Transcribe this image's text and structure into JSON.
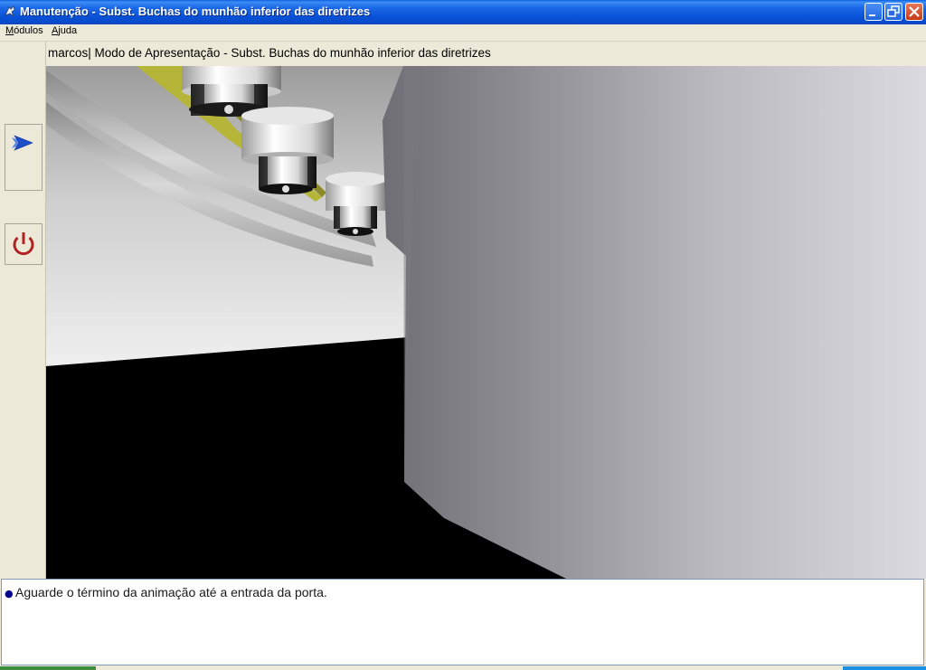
{
  "window": {
    "title": "Manutenção - Subst. Buchas do munhão inferior das diretrizes",
    "controls": [
      "minimize",
      "restore",
      "close"
    ]
  },
  "menubar": {
    "items": [
      {
        "label": "Módulos",
        "accel": "M",
        "rest": "ódulos"
      },
      {
        "label": "Ajuda",
        "accel": "A",
        "rest": "juda"
      }
    ]
  },
  "toolbar": {
    "buttons": [
      {
        "name": "next",
        "icon": "blue-arrow-right-icon"
      },
      {
        "name": "exit",
        "icon": "power-icon",
        "color": "#b22222"
      }
    ]
  },
  "header": {
    "text": "marcos| Modo de Apresentação - Subst. Buchas do munhão inferior das diretrizes"
  },
  "viewport": {
    "content": "3d-scene"
  },
  "instructions": {
    "items": [
      "Aguarde o término da animação até a entrada da porta."
    ]
  },
  "colors": {
    "titlebar": "#0a5fe0",
    "accent": "#2a5ad8",
    "power": "#b22222"
  }
}
